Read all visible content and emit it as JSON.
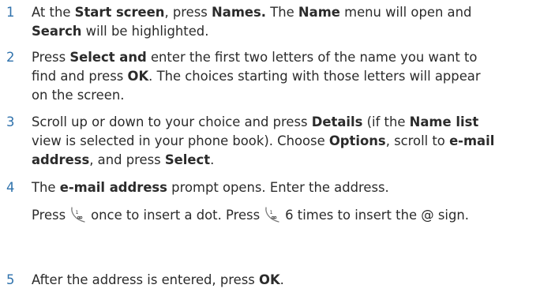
{
  "steps": [
    {
      "number": "1",
      "lines": [
        [
          {
            "t": "At the ",
            "b": false
          },
          {
            "t": "Start screen",
            "b": true
          },
          {
            "t": ", press ",
            "b": false
          },
          {
            "t": "Names.",
            "b": true
          },
          {
            "t": " The ",
            "b": false
          },
          {
            "t": "Name",
            "b": true
          },
          {
            "t": " menu will open and",
            "b": false
          }
        ],
        [
          {
            "t": "Search",
            "b": true
          },
          {
            "t": " will be highlighted.",
            "b": false
          }
        ]
      ]
    },
    {
      "number": "2",
      "lines": [
        [
          {
            "t": "Press ",
            "b": false
          },
          {
            "t": "Select and",
            "b": true
          },
          {
            "t": " enter the first two letters of the name you want to",
            "b": false
          }
        ],
        [
          {
            "t": "find and press ",
            "b": false
          },
          {
            "t": "OK",
            "b": true
          },
          {
            "t": ". The choices starting with those letters will appear",
            "b": false
          }
        ],
        [
          {
            "t": "on the screen.",
            "b": false
          }
        ]
      ]
    },
    {
      "number": "3",
      "lines": [
        [
          {
            "t": "Scroll up or down to your choice and press ",
            "b": false
          },
          {
            "t": "Details",
            "b": true
          },
          {
            "t": " (if the ",
            "b": false
          },
          {
            "t": "Name list",
            "b": true
          }
        ],
        [
          {
            "t": "view is selected in your phone book). Choose ",
            "b": false
          },
          {
            "t": "Options",
            "b": true
          },
          {
            "t": ", scroll to ",
            "b": false
          },
          {
            "t": "e-mail",
            "b": true
          }
        ],
        [
          {
            "t": "address",
            "b": true
          },
          {
            "t": ", and press ",
            "b": false
          },
          {
            "t": "Select",
            "b": true
          },
          {
            "t": ".",
            "b": false
          }
        ]
      ]
    },
    {
      "number": "4",
      "lines": [
        [
          {
            "t": "The ",
            "b": false
          },
          {
            "t": "e-mail address",
            "b": true
          },
          {
            "t": " prompt opens. Enter the address.",
            "b": false
          }
        ]
      ],
      "extra": {
        "press1": "Press",
        "after_icon1": "once to insert a dot. Press",
        "after_icon2": "6 times to insert the @ sign."
      },
      "icon": "key-1-voicemail-icon"
    },
    {
      "number": "5",
      "lines": [
        [
          {
            "t": "After the address is entered, press ",
            "b": false
          },
          {
            "t": "OK",
            "b": true
          },
          {
            "t": ".",
            "b": false
          }
        ]
      ]
    }
  ]
}
